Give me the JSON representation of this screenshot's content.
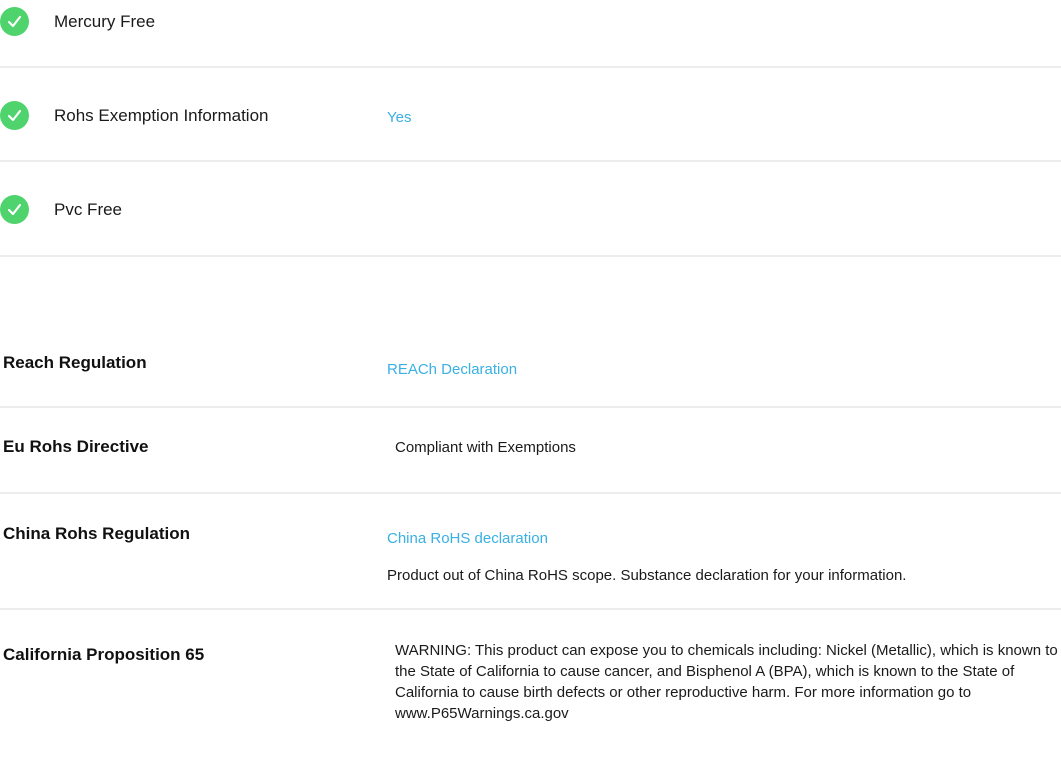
{
  "environment": {
    "items": [
      {
        "label": "Mercury Free",
        "icon": "check-circle-icon",
        "value": ""
      },
      {
        "label": "Rohs Exemption Information",
        "icon": "check-circle-icon",
        "value": "Yes"
      },
      {
        "label": "Pvc Free",
        "icon": "check-circle-icon",
        "value": ""
      }
    ]
  },
  "regulations": {
    "reach": {
      "title": "Reach Regulation",
      "link": "REACh Declaration"
    },
    "eu_rohs": {
      "title": "Eu Rohs Directive",
      "value": "Compliant with Exemptions"
    },
    "china_rohs": {
      "title": "China Rohs Regulation",
      "link": "China RoHS declaration",
      "note": "Product out of China RoHS scope. Substance declaration for your information."
    },
    "california": {
      "title": "California Proposition 65",
      "warning": "WARNING: This product can expose you to chemicals including: Nickel (Metallic), which is known to the State of California to cause cancer, and Bisphenol A (BPA), which is known to the State of California to cause birth defects or other reproductive harm. For more information go to www.P65Warnings.ca.gov"
    }
  },
  "colors": {
    "check_green": "#4fd36c",
    "link_blue": "#3ab0e4",
    "divider": "#ececec"
  }
}
